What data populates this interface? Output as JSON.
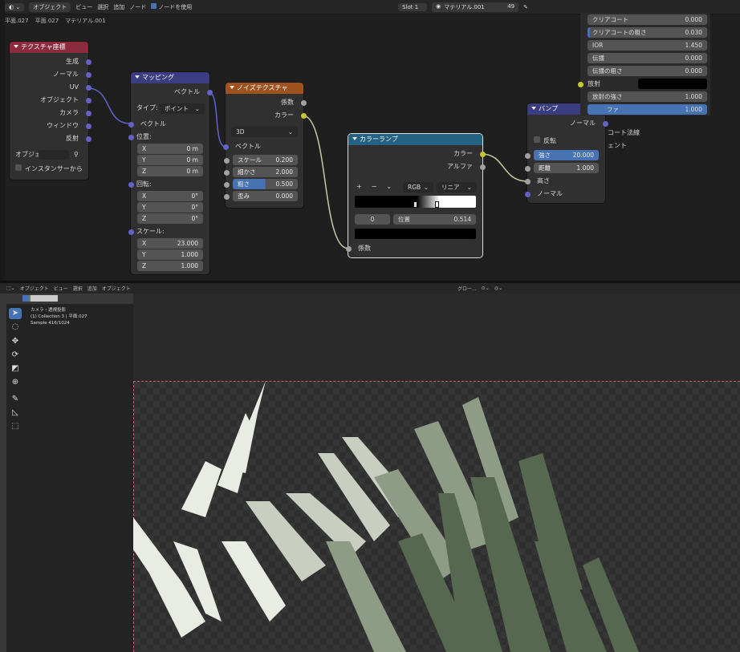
{
  "header": {
    "mode": "オブジェクト",
    "menus": [
      "ビュー",
      "選択",
      "追加",
      "ノード"
    ],
    "use_nodes": "ノードを使用",
    "slot": "Slot 1",
    "material": "マテリアル.001",
    "users": "49"
  },
  "breadcrumb": [
    "平面.027",
    "平面.027",
    "マテリアル.001"
  ],
  "nodes": {
    "texcoord": {
      "title": "テクスチャ座標",
      "outputs": [
        "生成",
        "ノーマル",
        "UV",
        "オブジェクト",
        "カメラ",
        "ウィンドウ",
        "反射"
      ],
      "object_label": "オブジェ",
      "instancer": "インスタンサーから"
    },
    "mapping": {
      "title": "マッピング",
      "out": "ベクトル",
      "type_label": "タイプ:",
      "type_value": "ポイント",
      "in_vector": "ベクトル",
      "loc_label": "位置:",
      "loc": [
        {
          "a": "X",
          "v": "0 m"
        },
        {
          "a": "Y",
          "v": "0 m"
        },
        {
          "a": "Z",
          "v": "0 m"
        }
      ],
      "rot_label": "回転:",
      "rot": [
        {
          "a": "X",
          "v": "0°"
        },
        {
          "a": "Y",
          "v": "0°"
        },
        {
          "a": "Z",
          "v": "0°"
        }
      ],
      "scale_label": "スケール:",
      "scale": [
        {
          "a": "X",
          "v": "23.000"
        },
        {
          "a": "Y",
          "v": "1.000"
        },
        {
          "a": "Z",
          "v": "1.000"
        }
      ]
    },
    "noise": {
      "title": "ノイズテクスチャ",
      "out1": "係数",
      "out2": "カラー",
      "dim": "3D",
      "in_vector": "ベクトル",
      "fields": [
        {
          "l": "スケール",
          "v": "0.200"
        },
        {
          "l": "細かさ",
          "v": "2.000"
        },
        {
          "l": "粗さ",
          "v": "0.500"
        },
        {
          "l": "歪み",
          "v": "0.000"
        }
      ]
    },
    "ramp": {
      "title": "カラーランプ",
      "out1": "カラー",
      "out2": "アルファ",
      "plus": "+",
      "minus": "−",
      "chev": "⌄",
      "mode": "RGB",
      "interp": "リニア",
      "index": "0",
      "pos_label": "位置",
      "pos_value": "0.514",
      "in_fac": "係数"
    },
    "bump": {
      "title": "バンプ",
      "out": "ノーマル",
      "invert": "反転",
      "fields": [
        {
          "l": "強さ",
          "v": "20.000"
        },
        {
          "l": "距離",
          "v": "1.000"
        }
      ],
      "in_height": "高さ",
      "in_normal": "ノーマル"
    }
  },
  "props": {
    "rows": [
      {
        "l": "クリアコート",
        "v": "0.000"
      },
      {
        "l": "クリアコートの粗さ",
        "v": "0.030"
      },
      {
        "l": "IOR",
        "v": "1.450"
      },
      {
        "l": "伝播",
        "v": "0.000"
      },
      {
        "l": "伝播の粗さ",
        "v": "0.000"
      }
    ],
    "emission": "放射",
    "emission_strength": {
      "l": "放射の強さ",
      "v": "1.000"
    },
    "alpha": {
      "l": "ファ",
      "v": "1.000"
    },
    "clearcoat_normal": "コート法線",
    "tangent": "ェント"
  },
  "viewport": {
    "mode": "オブジェクト",
    "menus": [
      "ビュー",
      "選択",
      "追加",
      "オブジェクト"
    ],
    "shading": "グロー...",
    "info1": "カメラ・透視投影",
    "info2": "(1) Collection 3 | 平面.027",
    "info3": "Sample 416/1024"
  }
}
